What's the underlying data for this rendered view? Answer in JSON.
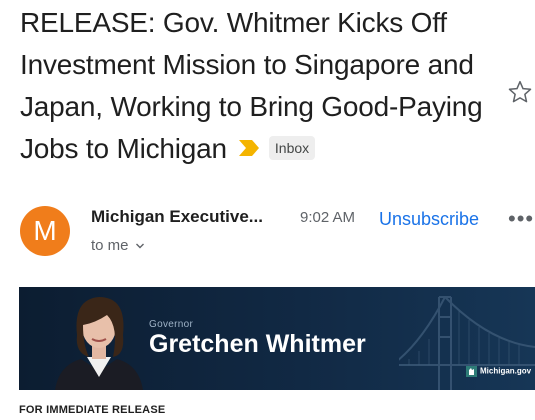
{
  "email": {
    "subject": "RELEASE: Gov. Whitmer Kicks Off Investment Mission to Singapore and Japan, Working to Bring Good-Paying Jobs to Michigan",
    "label": "Inbox",
    "sender_initial": "M",
    "sender_name": "Michigan Executive...",
    "time": "9:02 AM",
    "unsubscribe_label": "Unsubscribe",
    "more_label": "•••",
    "recipient_line": "to me"
  },
  "banner": {
    "title": "Governor",
    "name": "Gretchen Whitmer",
    "brand": "Michigan.gov"
  },
  "body": {
    "first_line": "FOR IMMEDIATE RELEASE"
  },
  "colors": {
    "avatar": "#f07d1b",
    "link": "#1a73e8",
    "important_marker": "#f4b400",
    "banner_bg": "#0c1d31"
  },
  "icons": {
    "important": "important-marker-icon",
    "star": "star-icon",
    "more": "more-options-icon",
    "expand": "chevron-down-icon"
  }
}
